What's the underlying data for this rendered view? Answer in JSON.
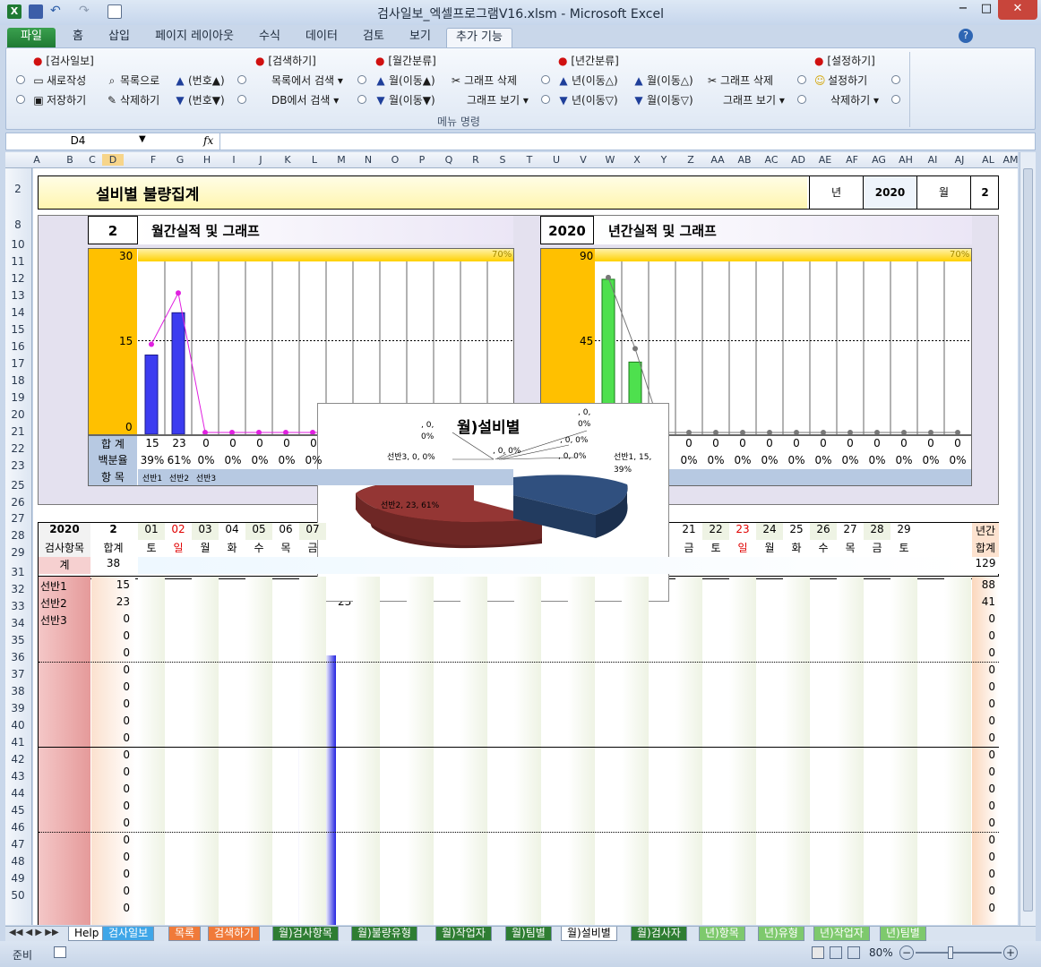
{
  "window": {
    "title": "검사일보_엑셀프로그램V16.xlsm - Microsoft Excel",
    "min": "−",
    "max": "□",
    "close": "✕"
  },
  "menu_tabs": [
    "파일",
    "홈",
    "삽입",
    "페이지 레이아웃",
    "수식",
    "데이터",
    "검토",
    "보기",
    "추가 기능"
  ],
  "ribbon": {
    "groups": [
      {
        "header": "[검사일보]",
        "items": [
          "새로작성",
          "목록으로",
          "(번호▲)",
          "저장하기",
          "삭제하기",
          "(번호▼)"
        ]
      },
      {
        "header": "[검색하기]",
        "items": [
          "목록에서 검색",
          "DB에서 검색"
        ]
      },
      {
        "header": "[월간분류]",
        "items": [
          "월(이동▲)",
          "그래프 삭제",
          "월(이동▼)",
          "그래프 보기"
        ]
      },
      {
        "header": "[년간분류]",
        "items": [
          "년(이동△)",
          "월(이동△)",
          "그래프 삭제",
          "년(이동▽)",
          "월(이동▽)",
          "그래프 보기"
        ]
      },
      {
        "header": "[설정하기]",
        "items": [
          "설정하기",
          "삭제하기"
        ]
      }
    ],
    "footer": "메뉴 명령"
  },
  "namebox": "D4",
  "fx": "fx",
  "columns": [
    "A",
    "B",
    "C",
    "D",
    "F",
    "G",
    "H",
    "I",
    "J",
    "K",
    "L",
    "M",
    "N",
    "O",
    "P",
    "Q",
    "R",
    "S",
    "T",
    "U",
    "V",
    "W",
    "X",
    "Y",
    "Z",
    "AA",
    "AB",
    "AC",
    "AD",
    "AE",
    "AF",
    "AG",
    "AH",
    "AI",
    "AJ",
    "AL",
    "AM"
  ],
  "rows": [
    "2",
    "8",
    "10",
    "11",
    "12",
    "13",
    "14",
    "15",
    "16",
    "17",
    "18",
    "19",
    "20",
    "21",
    "22",
    "23",
    "25",
    "26",
    "27",
    "28",
    "29",
    "31",
    "32",
    "33",
    "34",
    "35",
    "36",
    "37",
    "38",
    "39",
    "40",
    "41",
    "42",
    "43",
    "44",
    "45",
    "46",
    "47",
    "48",
    "49",
    "50"
  ],
  "report": {
    "title": "설비별 불량집계",
    "year_label": "년",
    "year": "2020",
    "month_label": "월",
    "month": "2"
  },
  "monthly": {
    "period": "2",
    "title": "월간실적 및 그래프",
    "ymax": "30",
    "ymid": "15",
    "ymin": "0",
    "pct": "70%",
    "row_total_label": "합 계",
    "row_pct_label": "백분율",
    "row_item_label": "항 목",
    "totals": [
      "15",
      "23",
      "0",
      "0",
      "0",
      "0",
      "0"
    ],
    "pcts": [
      "39%",
      "61%",
      "0%",
      "0%",
      "0%",
      "0%",
      "0%"
    ],
    "items": [
      "선반1",
      "선반2",
      "선반3"
    ]
  },
  "yearly": {
    "period": "2020",
    "title": "년간실적 및 그래프",
    "ymax": "90",
    "ymid": "45",
    "pct": "70%",
    "totals": [
      "0",
      "0",
      "0",
      "0",
      "0",
      "0",
      "0",
      "0",
      "0",
      "0",
      "0"
    ],
    "pcts": [
      "0%",
      "0%",
      "0%",
      "0%",
      "0%",
      "0%",
      "0%",
      "0%",
      "0%",
      "0%",
      "0%"
    ],
    "item_tail": "3"
  },
  "pie": {
    "title": "월)설비별",
    "labels": {
      "s1": "선반1, 15, 39%",
      "s2": "선반2, 23, 61%",
      "s3": "선반3, 0, 0%",
      "z1": ", 0, 0%",
      "z2": ", 0, 0%",
      "z3": ", 0, 0%",
      "z4": ", 0, 0%",
      "z5": ", 0, 0%"
    },
    "colors": {
      "s1": "#2f4f7f",
      "s2": "#943634"
    }
  },
  "chart_data": [
    {
      "type": "bar",
      "title": "월간실적 및 그래프",
      "categories": [
        "선반1",
        "선반2",
        "선반3"
      ],
      "values": [
        15,
        23,
        0
      ],
      "ylim": [
        0,
        30
      ]
    },
    {
      "type": "bar",
      "title": "년간실적 및 그래프",
      "categories": [
        "선반1",
        "선반2",
        "선반3"
      ],
      "values": [
        88,
        41,
        0
      ],
      "ylim": [
        0,
        90
      ]
    },
    {
      "type": "pie",
      "title": "월)설비별",
      "categories": [
        "선반1",
        "선반2",
        "선반3"
      ],
      "values": [
        15,
        23,
        0
      ],
      "percentages": [
        39,
        61,
        0
      ]
    }
  ],
  "table": {
    "year": "2020",
    "month": "2",
    "annual_header1": "년간",
    "annual_header2": "합계",
    "item_header": "검사항목",
    "sum_header": "합계",
    "total_label": "계",
    "total": "38",
    "annual_total": "129",
    "day_tail_total": "15",
    "days": [
      "01",
      "02",
      "03",
      "04",
      "05",
      "06",
      "07"
    ],
    "weekdays": [
      "토",
      "일",
      "월",
      "화",
      "수",
      "목",
      "금"
    ],
    "days_right": [
      "21",
      "22",
      "23",
      "24",
      "25",
      "26",
      "27",
      "28",
      "29"
    ],
    "weekdays_right": [
      "금",
      "토",
      "일",
      "월",
      "화",
      "수",
      "목",
      "금",
      "토"
    ],
    "items": [
      "선반1",
      "선반2",
      "선반3",
      "",
      "",
      "",
      "",
      "",
      "",
      "",
      "",
      "",
      "",
      "",
      "",
      "",
      "",
      "",
      "",
      ""
    ],
    "sums": [
      "15",
      "23",
      "0",
      "0",
      "0",
      "0",
      "0",
      "0",
      "0",
      "0",
      "0",
      "0",
      "0",
      "0",
      "0",
      "0",
      "0",
      "0",
      "0",
      "0"
    ],
    "annual": [
      "88",
      "41",
      "0",
      "0",
      "0",
      "0",
      "0",
      "0",
      "0",
      "0",
      "0",
      "0",
      "0",
      "0",
      "0",
      "0",
      "0",
      "0",
      "0",
      "0"
    ],
    "cell_peek1": "1",
    "cell_peek2": "23"
  },
  "sheet_tabs": [
    "Help",
    "검사일보",
    "목록",
    "검색하기",
    "월)검사항목",
    "월)불량유형",
    "월)작업자",
    "월)팀별",
    "월)설비별",
    "월)검사자",
    "년)항목",
    "년)유형",
    "년)작업자",
    "년)팀별"
  ],
  "status": {
    "ready": "준비",
    "zoom": "80%"
  }
}
